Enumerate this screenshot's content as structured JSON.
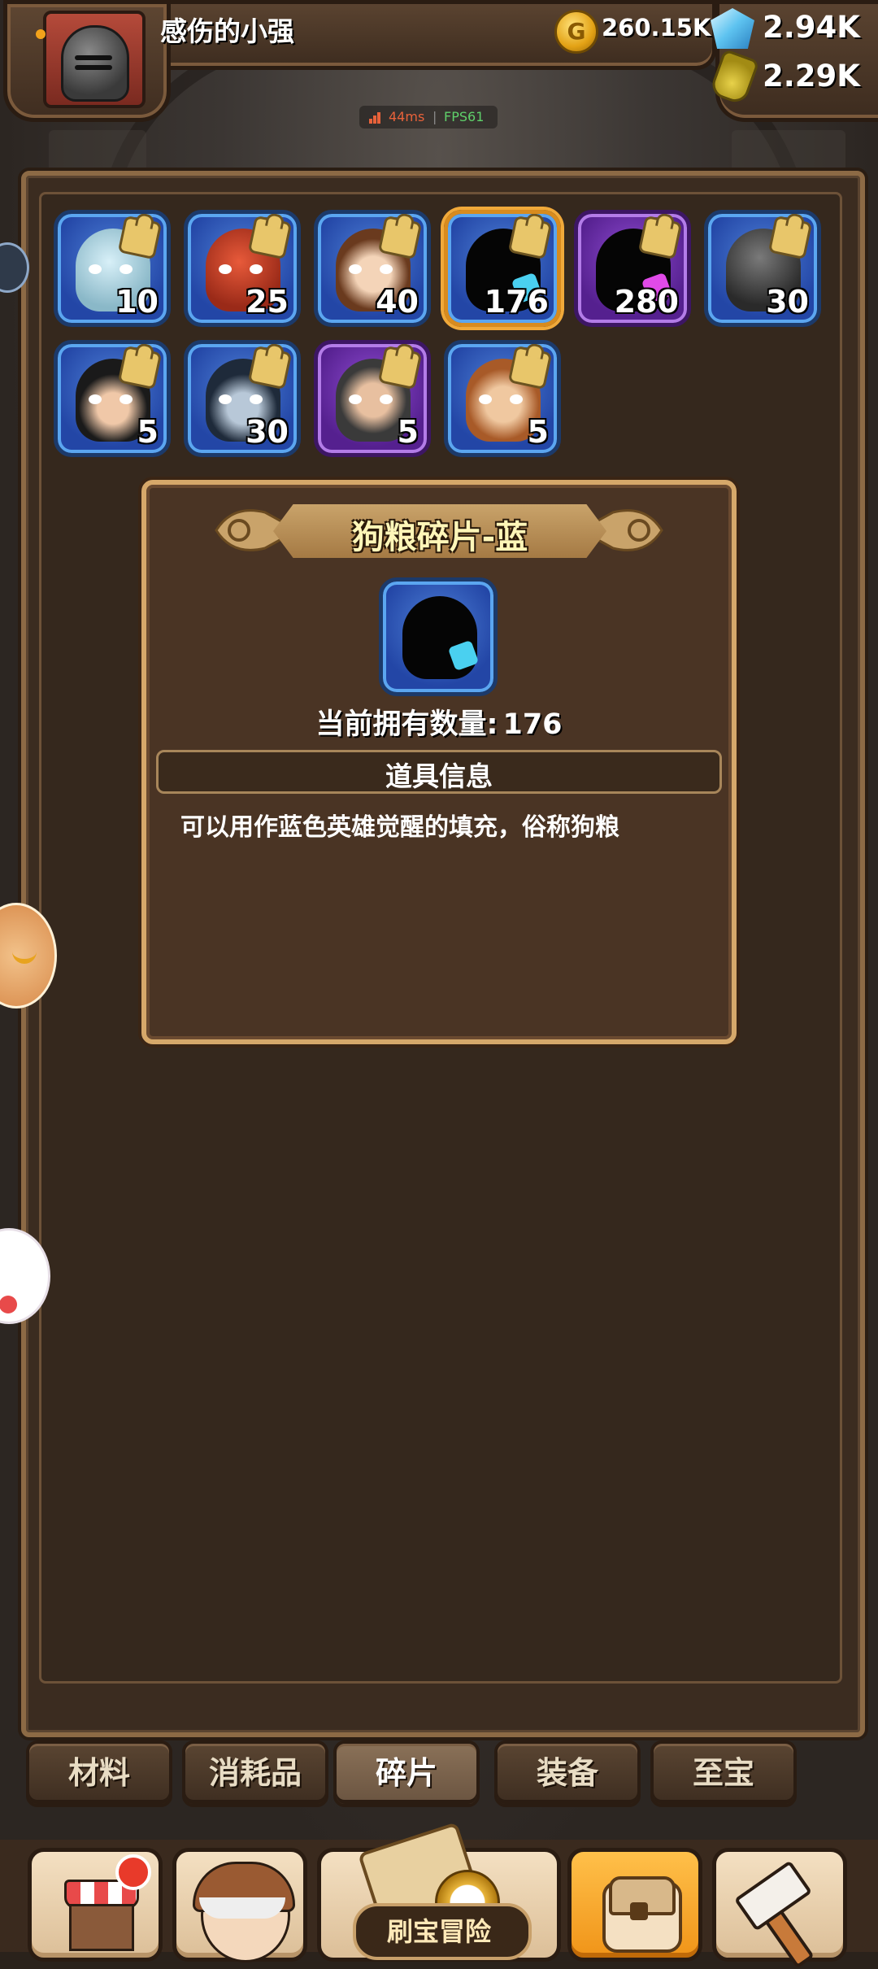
{
  "header": {
    "player_name": "感伤的小强",
    "gold_symbol": "G",
    "gold": "260.15K",
    "gems": "2.94K",
    "potions": "2.29K",
    "icons": [
      "avatar-knight-helmet",
      "gold-coin-icon",
      "blue-gem-icon",
      "potion-bottle-icon"
    ]
  },
  "net_stats": {
    "ping": "44ms",
    "separator": "|",
    "fps": "FPS61"
  },
  "items": [
    {
      "count": "10",
      "rarity": "blue",
      "icon": "ice-golem-fragment"
    },
    {
      "count": "25",
      "rarity": "blue",
      "icon": "red-demon-fragment"
    },
    {
      "count": "40",
      "rarity": "blue",
      "icon": "girl-hero-fragment"
    },
    {
      "count": "176",
      "rarity": "blue",
      "icon": "silhouette-fragment-blue",
      "selected": true
    },
    {
      "count": "280",
      "rarity": "purple",
      "icon": "silhouette-fragment-purple"
    },
    {
      "count": "30",
      "rarity": "blue",
      "icon": "dark-knight-fragment"
    },
    {
      "count": "5",
      "rarity": "blue",
      "icon": "ninja-fragment"
    },
    {
      "count": "30",
      "rarity": "blue",
      "icon": "hooded-skull-fragment"
    },
    {
      "count": "5",
      "rarity": "purple",
      "icon": "bearded-man-fragment"
    },
    {
      "count": "5",
      "rarity": "blue",
      "icon": "warrior-woman-fragment"
    }
  ],
  "detail": {
    "title": "狗粮碎片-蓝",
    "owned_label": "当前拥有数量:",
    "owned_count": "176",
    "info_header": "道具信息",
    "description": "可以用作蓝色英雄觉醒的填充，俗称狗粮"
  },
  "tabs": [
    {
      "label": "材料",
      "active": false
    },
    {
      "label": "消耗品",
      "active": false
    },
    {
      "label": "碎片",
      "active": true
    },
    {
      "label": "装备",
      "active": false
    },
    {
      "label": "至宝",
      "active": false
    }
  ],
  "bottom_nav": {
    "adventure_label": "刷宝冒险",
    "items": [
      "shop-icon",
      "hero-icon",
      "adventure-map-icon",
      "backpack-icon",
      "forge-hammer-icon"
    ],
    "active": "backpack-icon"
  },
  "colors": {
    "panel_border": "#8c6a45",
    "blue_frame": "#2346a6",
    "purple_frame": "#55208f",
    "selected_frame": "#f0a93a",
    "active_nav": "#f09418"
  }
}
